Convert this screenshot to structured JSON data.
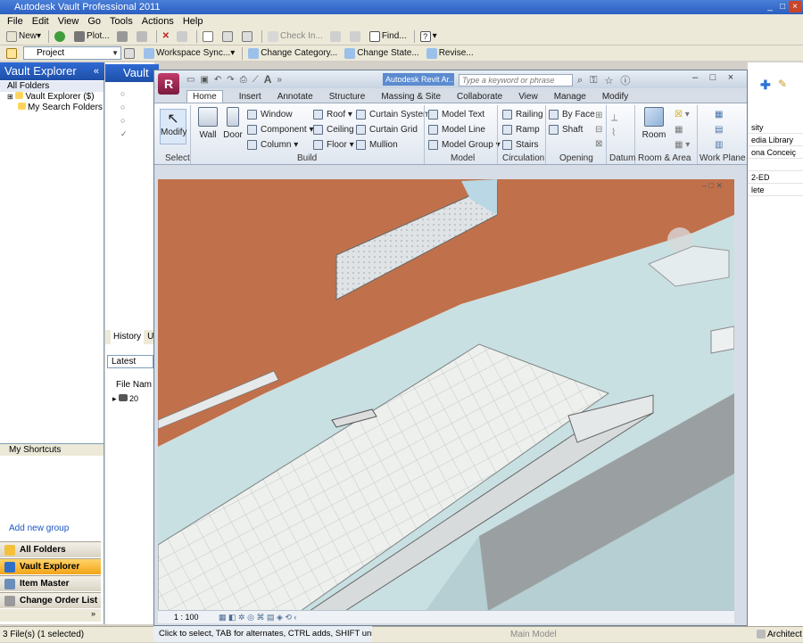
{
  "vault": {
    "title": "Autodesk Vault Professional 2011",
    "menu": [
      "File",
      "Edit",
      "View",
      "Go",
      "Tools",
      "Actions",
      "Help"
    ],
    "toolbar1": {
      "new": "New",
      "plot": "Plot...",
      "check_in": "Check In...",
      "find": "Find..."
    },
    "toolbar2": {
      "project_combo": "Project",
      "workspace_sync": "Workspace Sync...",
      "change_category": "Change Category...",
      "change_state": "Change State...",
      "revise": "Revise..."
    },
    "left_pane": {
      "header": "Vault Explorer",
      "tree": [
        "All Folders",
        "Vault Explorer ($)",
        "My Search Folders"
      ],
      "shortcuts": "My Shortcuts",
      "add_group": "Add new group",
      "nav": [
        "All Folders",
        "Vault Explorer",
        "Item Master",
        "Change Order List"
      ]
    },
    "middle_pane": {
      "header": "Vault",
      "tabs": [
        "History",
        "Us"
      ],
      "latest": "Latest",
      "file_name_header": "File Nam",
      "year_prefix": "20"
    },
    "right_pane": {
      "props": [
        "sity",
        "edia Library",
        "ona Conceiç",
        "",
        "2-ED",
        "lete"
      ]
    },
    "status": "3 File(s) (1 selected)",
    "status_right": "Architect"
  },
  "revit": {
    "title": "Autodesk Revit Ar...",
    "search_placeholder": "Type a keyword or phrase",
    "tabs": [
      "Home",
      "Insert",
      "Annotate",
      "Structure",
      "Massing & Site",
      "Collaborate",
      "View",
      "Manage",
      "Modify"
    ],
    "ribbon": {
      "modify": "Modify",
      "wall": "Wall",
      "door": "Door",
      "build_col1": [
        "Window",
        "Component",
        "Column"
      ],
      "build_col2": [
        "Roof",
        "Ceiling",
        "Floor"
      ],
      "build_col3": [
        "Curtain System",
        "Curtain Grid",
        "Mullion"
      ],
      "model_col": [
        "Model Text",
        "Model Line",
        "Model Group"
      ],
      "circ_col": [
        "Railing",
        "Ramp",
        "Stairs"
      ],
      "opening_col": [
        "By Face",
        "Shaft"
      ],
      "room": "Room",
      "panels": [
        "Select",
        "Build",
        "Model",
        "Circulation",
        "Opening",
        "Datum",
        "Room & Area",
        "Work Plane"
      ]
    },
    "view_scale": "1 : 100",
    "status_hint": "Click to select, TAB for alternates, CTRL adds, SHIFT unselects",
    "main_model": "Main Model"
  },
  "colors": {
    "vault_header": "#1e4fa8",
    "vault_active_nav": "#f2a417",
    "wall_brown": "#c0704b",
    "floor_tile": "#e9ecea",
    "floor_blue": "#c7dde0"
  }
}
